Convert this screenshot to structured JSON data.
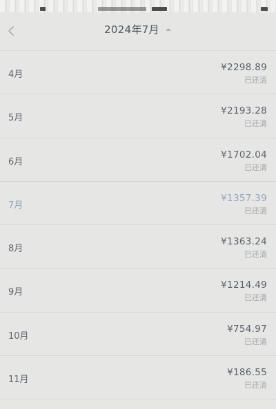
{
  "header": {
    "title": "2024年7月",
    "back_icon": "chevron-left-icon",
    "picker_icon": "caret-up-icon"
  },
  "colors": {
    "background": "#e6e6e4",
    "text": "#59636d",
    "active": "#8fa6c5",
    "muted": "#a3a8ad"
  },
  "months": [
    {
      "label": "4月",
      "amount": "¥2298.89",
      "status": "已还清"
    },
    {
      "label": "5月",
      "amount": "¥2193.28",
      "status": "已还清"
    },
    {
      "label": "6月",
      "amount": "¥1702.04",
      "status": "已还清"
    },
    {
      "label": "7月",
      "amount": "¥1357.39",
      "status": "已还清",
      "active": true
    },
    {
      "label": "8月",
      "amount": "¥1363.24",
      "status": "已还清"
    },
    {
      "label": "9月",
      "amount": "¥1214.49",
      "status": "已还清"
    },
    {
      "label": "10月",
      "amount": "¥754.97",
      "status": "已还清"
    },
    {
      "label": "11月",
      "amount": "¥186.55",
      "status": "已还清"
    }
  ]
}
